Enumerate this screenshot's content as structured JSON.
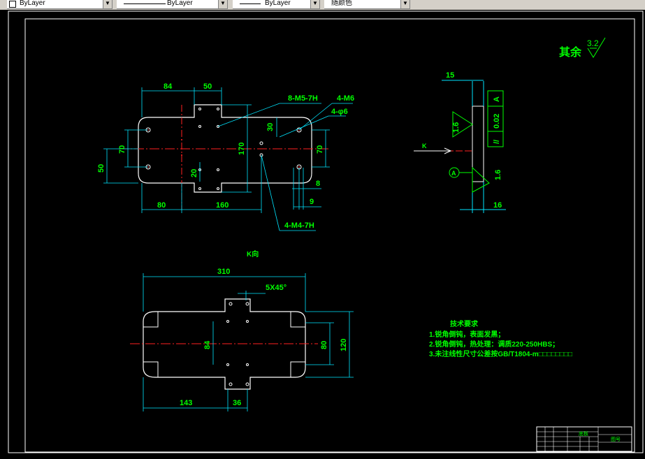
{
  "toolbar": {
    "layer": "ByLayer",
    "linetype": "ByLayer",
    "lineweight": "ByLayer",
    "color": "随颜色"
  },
  "drawing": {
    "roughness_label": "其余",
    "roughness_value": "3.2",
    "top_view": {
      "dim_84": "84",
      "dim_50_top": "50",
      "dim_70_left": "70",
      "dim_50_left": "50",
      "dim_20_mid": "20",
      "dim_170": "170",
      "dim_30": "30",
      "dim_70_right": "70",
      "dim_80": "80",
      "dim_160": "160",
      "dim_8": "8",
      "dim_9": "9",
      "note_8m5": "8-M5-7H",
      "note_4m6": "4-M6",
      "note_4phi6": "4-φ6",
      "note_4m4": "4-M4-7H"
    },
    "side_view": {
      "dim_15": "15",
      "dim_16": "16",
      "rough_1": "1.6",
      "rough_2": "1.6",
      "tol_parallel": "//",
      "tol_value": "0.02",
      "tol_datum": "A",
      "view_mark": "K",
      "datum_letter": "A"
    },
    "bottom_view": {
      "view_title": "K向",
      "dim_310": "310",
      "chamfer": "5X45°",
      "dim_84": "84",
      "dim_80": "80",
      "dim_120": "120",
      "dim_143": "143",
      "dim_36": "36"
    },
    "tech": {
      "title": "技术要求",
      "line1": "1.锐角倒钝，表面发黑；",
      "line2": "2.锐角倒钝，热处理：调质220-250HBS；",
      "line3": "3.未注线性尺寸公差按GB/T1804-m□□□□□□□□"
    },
    "title_block": {
      "name": "底板",
      "code": "图号"
    }
  }
}
